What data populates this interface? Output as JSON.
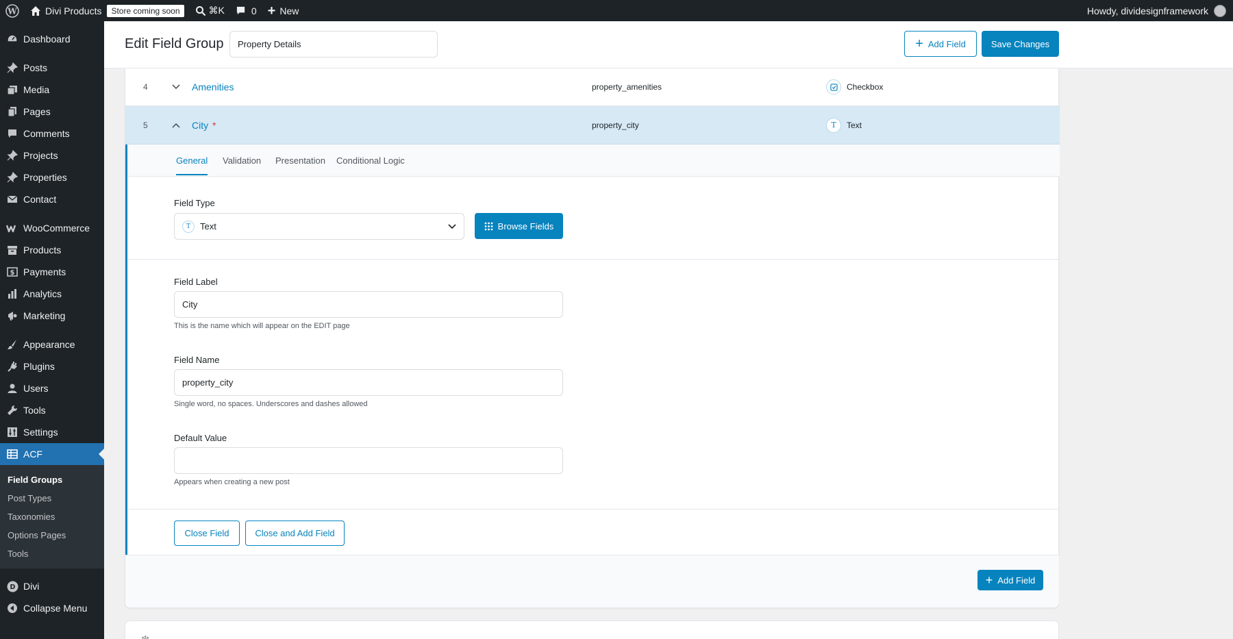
{
  "admin_bar": {
    "site_name": "Divi Products",
    "store_badge": "Store coming soon",
    "search_shortcut": "⌘K",
    "comments_count": "0",
    "new_label": "New",
    "howdy": "Howdy, dividesignframework"
  },
  "sidebar": {
    "items": [
      {
        "label": "Dashboard",
        "icon": "dashboard-icon"
      },
      {
        "label": "Posts",
        "icon": "pin-icon"
      },
      {
        "label": "Media",
        "icon": "media-icon"
      },
      {
        "label": "Pages",
        "icon": "pages-icon"
      },
      {
        "label": "Comments",
        "icon": "comment-icon"
      },
      {
        "label": "Projects",
        "icon": "pin-icon"
      },
      {
        "label": "Properties",
        "icon": "pin-icon"
      },
      {
        "label": "Contact",
        "icon": "mail-icon"
      },
      {
        "label": "WooCommerce",
        "icon": "woo-icon"
      },
      {
        "label": "Products",
        "icon": "archive-icon"
      },
      {
        "label": "Payments",
        "icon": "dollar-icon"
      },
      {
        "label": "Analytics",
        "icon": "bar-chart-icon"
      },
      {
        "label": "Marketing",
        "icon": "megaphone-icon"
      },
      {
        "label": "Appearance",
        "icon": "brush-icon"
      },
      {
        "label": "Plugins",
        "icon": "plug-icon"
      },
      {
        "label": "Users",
        "icon": "user-icon"
      },
      {
        "label": "Tools",
        "icon": "wrench-icon"
      },
      {
        "label": "Settings",
        "icon": "sliders-icon"
      },
      {
        "label": "ACF",
        "icon": "acf-icon"
      }
    ],
    "submenu": [
      "Field Groups",
      "Post Types",
      "Taxonomies",
      "Options Pages",
      "Tools"
    ],
    "bottom": [
      {
        "label": "Divi",
        "icon": "divi-icon"
      },
      {
        "label": "Collapse Menu",
        "icon": "collapse-icon"
      }
    ]
  },
  "header": {
    "title": "Edit Field Group",
    "group_name": "Property Details",
    "add_field": "Add Field",
    "save_changes": "Save Changes"
  },
  "fields": [
    {
      "num": "4",
      "label": "Amenities",
      "name": "property_amenities",
      "type": "Checkbox",
      "required": ""
    },
    {
      "num": "5",
      "label": "City",
      "name": "property_city",
      "type": "Text",
      "required": "*"
    }
  ],
  "tabs": [
    "General",
    "Validation",
    "Presentation",
    "Conditional Logic"
  ],
  "form": {
    "field_type_label": "Field Type",
    "field_type_value": "Text",
    "browse_fields": "Browse Fields",
    "field_label_label": "Field Label",
    "field_label_value": "City",
    "field_label_help": "This is the name which will appear on the EDIT page",
    "field_name_label": "Field Name",
    "field_name_value": "property_city",
    "field_name_help": "Single word, no spaces. Underscores and dashes allowed",
    "default_value_label": "Default Value",
    "default_value_value": "",
    "default_value_help": "Appears when creating a new post",
    "close_field": "Close Field",
    "close_and_add": "Close and Add Field",
    "add_field": "Add Field"
  },
  "colors": {
    "accent": "#0783be",
    "admin_bg": "#1d2327",
    "active_menu": "#2271b1",
    "open_row_bg": "#d6e9f5",
    "required": "#d63638"
  }
}
